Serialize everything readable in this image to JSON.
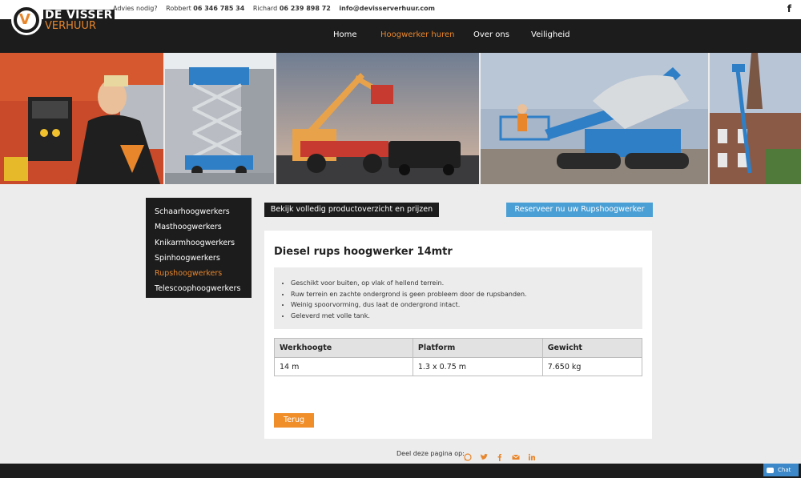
{
  "brand": {
    "line1": "DE VISSER",
    "line2": "VERHUUR",
    "mark": "V",
    "accent": "#e8862c"
  },
  "contact": {
    "prefix": "Advies nodig?",
    "person1": "Robbert",
    "phone1": "06 346 785 34",
    "person2": "Richard",
    "phone2": "06 239 898 72",
    "email": "info@devisserverhuur.com",
    "social_icon": "facebook-icon"
  },
  "nav": {
    "items": [
      "Home",
      "Hoogwerker huren",
      "Over ons",
      "Veiligheid"
    ],
    "active": "Hoogwerker huren"
  },
  "sidebar": {
    "items": [
      {
        "label": "Schaarhoogwerkers"
      },
      {
        "label": "Masthoogwerkers"
      },
      {
        "label": "Knikarmhoogwerkers"
      },
      {
        "label": "Spinhoogwerkers"
      },
      {
        "label": "Rupshoogwerkers"
      },
      {
        "label": "Telescoophoogwerkers"
      }
    ],
    "active": "Rupshoogwerkers"
  },
  "actions": {
    "overview": "Bekijk volledig productoverzicht en prijzen",
    "reserve": "Reserveer nu uw Rupshoogwerker"
  },
  "product": {
    "title": "Diesel rups hoogwerker 14mtr",
    "features": [
      "Geschikt voor buiten, op vlak of hellend terrein.",
      "Ruw terrein en zachte ondergrond is geen probleem door de rupsbanden.",
      "Weinig spoorvorming, dus laat de ondergrond intact.",
      "Geleverd met volle tank."
    ],
    "spec_headers": [
      "Werkhoogte",
      "Platform",
      "Gewicht"
    ],
    "spec_values": [
      "14 m",
      "1.3 x 0.75 m",
      "7.650 kg"
    ],
    "back": "Terug"
  },
  "share": {
    "label": "Deel deze pagina op:",
    "icons": [
      "whatsapp-icon",
      "twitter-icon",
      "facebook-icon",
      "mail-icon",
      "linkedin-icon"
    ]
  },
  "chat": {
    "label": "Chat"
  },
  "colors": {
    "dark": "#1c1c1c",
    "orange": "#e8862c",
    "blue": "#4a9fd5",
    "background": "#ececec"
  }
}
